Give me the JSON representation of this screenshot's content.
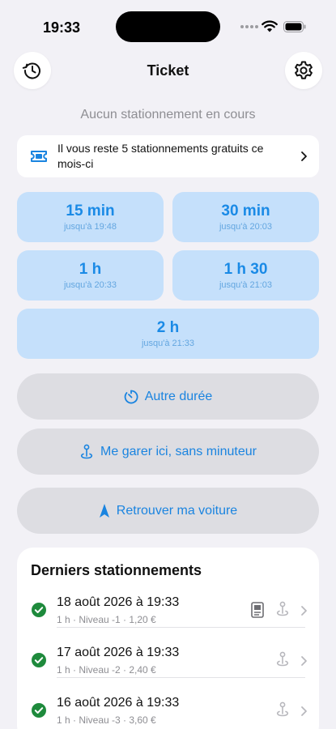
{
  "status_bar": {
    "time": "19:33"
  },
  "header": {
    "title": "Ticket",
    "left_icon": "history-icon",
    "right_icon": "gear-icon"
  },
  "status_message": "Aucun stationnement en cours",
  "free_banner": {
    "text": "Il vous reste 5 stationnements gratuits ce mois-ci",
    "icon": "ticket-icon"
  },
  "durations": [
    {
      "label": "15 min",
      "until": "jusqu'à 19:48"
    },
    {
      "label": "30 min",
      "until": "jusqu'à 20:03"
    },
    {
      "label": "1 h",
      "until": "jusqu'à 20:33"
    },
    {
      "label": "1 h 30",
      "until": "jusqu'à 21:03"
    },
    {
      "label": "2 h",
      "until": "jusqu'à 21:33"
    }
  ],
  "actions": {
    "other_duration": "Autre durée",
    "park_here": "Me garer ici, sans minuteur",
    "find_car": "Retrouver ma voiture"
  },
  "recent": {
    "title": "Derniers stationnements",
    "items": [
      {
        "title": "18 août 2026 à 19:33",
        "subtitle": "1 h · Niveau -1 · 1,20 €",
        "has_receipt": true
      },
      {
        "title": "17 août 2026 à 19:33",
        "subtitle": "1 h · Niveau -2 · 2,40 €",
        "has_receipt": false
      },
      {
        "title": "16 août 2026 à 19:33",
        "subtitle": "1 h · Niveau -3 · 3,60 €",
        "has_receipt": false
      }
    ]
  },
  "colors": {
    "background": "#f2f1f6",
    "accent": "#1a8ae6",
    "duration_bg": "#c5e0fb",
    "pill_bg": "#dddde2",
    "success": "#1e8a3c"
  }
}
